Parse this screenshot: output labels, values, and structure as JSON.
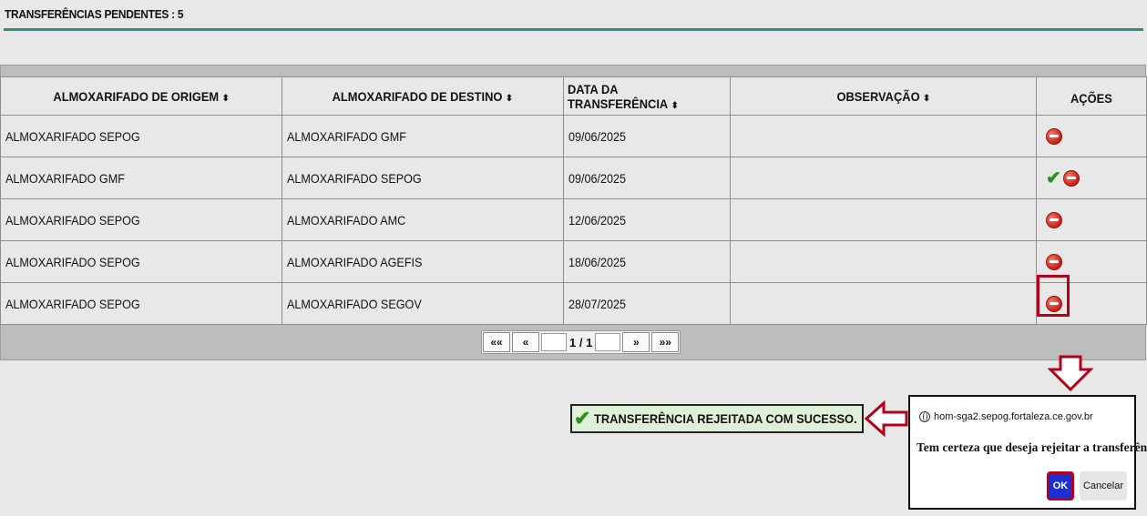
{
  "header": {
    "title": "TRANSFERÊNCIAS PENDENTES : 5"
  },
  "table": {
    "columns": [
      "ALMOXARIFADO DE ORIGEM",
      "ALMOXARIFADO DE DESTINO",
      "DATA DA TRANSFERÊNCIA",
      "OBSERVAÇÃO",
      "AÇÕES"
    ],
    "sort_icon": "⬍",
    "rows": [
      {
        "origem": "ALMOXARIFADO SEPOG",
        "destino": "ALMOXARIFADO GMF",
        "data": "09/06/2025",
        "observacao": ""
      },
      {
        "origem": "ALMOXARIFADO GMF",
        "destino": "ALMOXARIFADO SEPOG",
        "data": "09/06/2025",
        "observacao": ""
      },
      {
        "origem": "ALMOXARIFADO SEPOG",
        "destino": "ALMOXARIFADO AMC",
        "data": "12/06/2025",
        "observacao": ""
      },
      {
        "origem": "ALMOXARIFADO SEPOG",
        "destino": "ALMOXARIFADO AGEFIS",
        "data": "18/06/2025",
        "observacao": ""
      },
      {
        "origem": "ALMOXARIFADO SEPOG",
        "destino": "ALMOXARIFADO SEGOV",
        "data": "28/07/2025",
        "observacao": ""
      }
    ]
  },
  "pager": {
    "first": "««",
    "prev": "«",
    "info": "1 / 1",
    "next": "»",
    "last": "»»"
  },
  "success": {
    "message": "TRANSFERÊNCIA REJEITADA COM SUCESSO."
  },
  "dialog": {
    "url": "hom-sga2.sepog.fortaleza.ce.gov.br",
    "message": "Tem certeza que deseja rejeitar a transferência?",
    "ok_label": "OK",
    "cancel_label": "Cancelar"
  },
  "colors": {
    "accent_line": "#2e8b7f",
    "highlight": "#b3001b",
    "ok_button": "#1a2fd6",
    "success_bg": "#dff0d8"
  },
  "icons": {
    "reject": "reject-icon",
    "approve": "approve-check-icon",
    "globe": "globe-icon"
  }
}
